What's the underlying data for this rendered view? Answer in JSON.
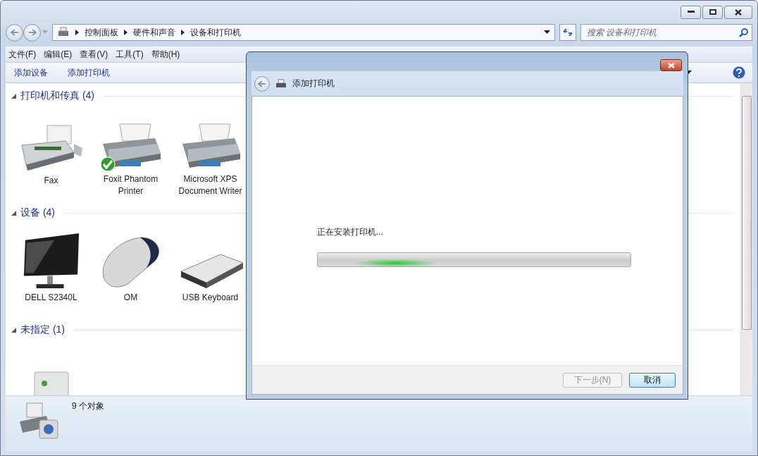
{
  "address_bar": {
    "crumbs": [
      "控制面板",
      "硬件和声音",
      "设备和打印机"
    ]
  },
  "search": {
    "placeholder": "搜索 设备和打印机"
  },
  "menu": [
    "文件(F)",
    "编辑(E)",
    "查看(V)",
    "工具(T)",
    "帮助(H)"
  ],
  "toolbar": [
    "添加设备",
    "添加打印机"
  ],
  "groups": [
    {
      "title": "打印机和传真 (4)",
      "expanded": true,
      "items": [
        {
          "label": "Fax",
          "kind": "fax",
          "default": false
        },
        {
          "label": "Foxit Phantom Printer",
          "kind": "printer",
          "default": true
        },
        {
          "label": "Microsoft XPS Document Writer",
          "kind": "printer",
          "default": false
        }
      ]
    },
    {
      "title": "设备 (4)",
      "expanded": true,
      "items": [
        {
          "label": "DELL S2340L",
          "kind": "monitor",
          "default": false
        },
        {
          "label": "OM",
          "kind": "mouse",
          "default": false
        },
        {
          "label": "USB Keyboard",
          "kind": "keyboard",
          "default": false
        }
      ]
    },
    {
      "title": "未指定 (1)",
      "expanded": true,
      "items": [
        {
          "kind": "tower",
          "default": false
        }
      ]
    }
  ],
  "status_bar": {
    "count": "9 个对象"
  },
  "dialog": {
    "title": "添加打印机",
    "message": "正在安装打印机...",
    "progress": {
      "indeterminate": true
    },
    "buttons": [
      {
        "label": "下一步(N)",
        "disabled": true
      },
      {
        "label": "取消",
        "disabled": false
      }
    ]
  }
}
